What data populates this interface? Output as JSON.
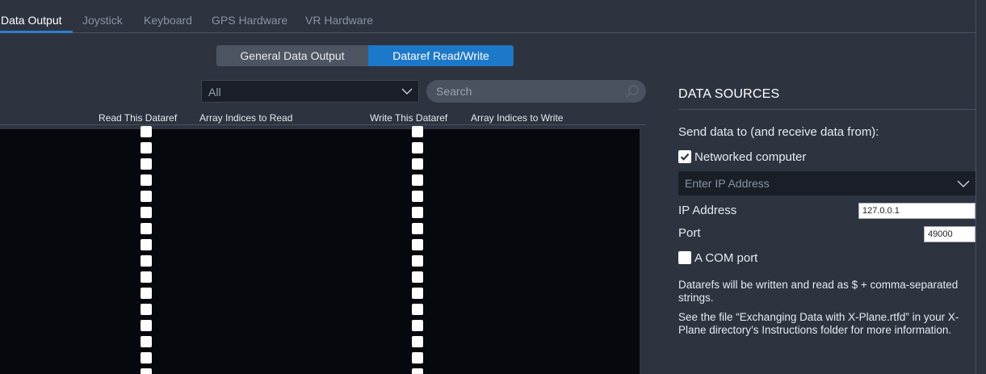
{
  "top_tabs": [
    {
      "label": "Data Output",
      "active": true
    },
    {
      "label": "Joystick"
    },
    {
      "label": "Keyboard"
    },
    {
      "label": "GPS Hardware"
    },
    {
      "label": "VR Hardware"
    }
  ],
  "segments": {
    "general": "General Data Output",
    "dataref": "Dataref Read/Write",
    "selected": "dataref"
  },
  "filter": {
    "selected": "All"
  },
  "search": {
    "placeholder": "Search"
  },
  "columns": {
    "read": "Read This Dataref",
    "read_indices": "Array Indices to Read",
    "write": "Write This Dataref",
    "write_indices": "Array Indices to Write"
  },
  "rows": {
    "count": 16,
    "read_checked": false,
    "write_checked": false
  },
  "data_sources": {
    "title": "DATA SOURCES",
    "send_label": "Send data to (and receive data from):",
    "networked_label": "Networked computer",
    "networked_checked": true,
    "ip_select_placeholder": "Enter IP Address",
    "ip_label": "IP Address",
    "ip_value": "127.0.0.1",
    "port_label": "Port",
    "port_value": "49000",
    "com_label": "A COM port",
    "com_checked": false,
    "note1": "Datarefs will be written and read as $ + comma-separated strings.",
    "note2": "See the file “Exchanging Data with X-Plane.rtfd” in your X-Plane directory’s Instructions folder for more information."
  },
  "colors": {
    "background": "#2d3440",
    "accent": "#1c78c9",
    "list_background": "#05080c"
  },
  "icons": [
    "chevron-down-icon",
    "search-icon",
    "checkmark-icon"
  ]
}
